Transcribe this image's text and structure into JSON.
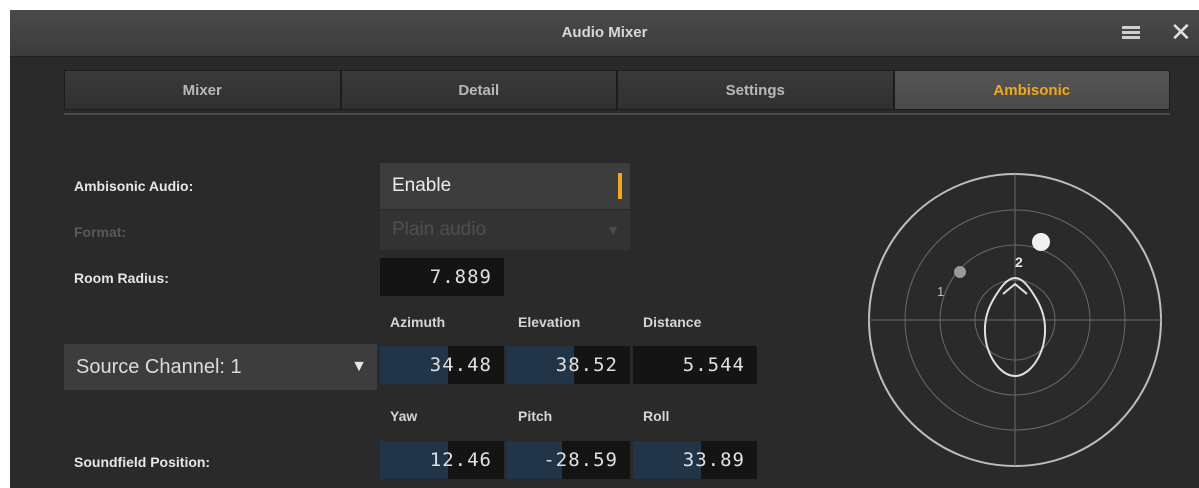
{
  "window": {
    "title": "Audio Mixer",
    "menu_icon": "hamburger-menu-icon",
    "close_icon": "close-icon",
    "close_glyph": "✕"
  },
  "tabs": [
    {
      "label": "Mixer",
      "active": false
    },
    {
      "label": "Detail",
      "active": false
    },
    {
      "label": "Settings",
      "active": false
    },
    {
      "label": "Ambisonic",
      "active": true
    }
  ],
  "colors": {
    "accent": "#f0a81e",
    "background": "#2a2a2a",
    "field_dark": "#141414",
    "field_fill": "#223548"
  },
  "ambisonic_audio": {
    "label": "Ambisonic Audio:",
    "value": "Enable"
  },
  "format": {
    "label": "Format:",
    "value": "Plain audio",
    "disabled": true,
    "caret": "▼"
  },
  "room_radius": {
    "label": "Room Radius:",
    "value": "7.889"
  },
  "source": {
    "selected": "Source Channel: 1",
    "caret": "▼",
    "headers": {
      "azimuth": "Azimuth",
      "elevation": "Elevation",
      "distance": "Distance"
    },
    "azimuth": {
      "value": "34.48",
      "fill": 0.55
    },
    "elevation": {
      "value": "38.52",
      "fill": 0.55
    },
    "distance": {
      "value": "5.544"
    }
  },
  "soundfield": {
    "label": "Soundfield Position:",
    "headers": {
      "yaw": "Yaw",
      "pitch": "Pitch",
      "roll": "Roll"
    },
    "yaw": {
      "value": "12.46",
      "fill": 0.55
    },
    "pitch": {
      "value": "-28.59",
      "fill": 0.45
    },
    "roll": {
      "value": "33.89",
      "fill": 0.55
    }
  },
  "panner": {
    "sources": [
      {
        "label": "1"
      },
      {
        "label": "2"
      }
    ]
  }
}
